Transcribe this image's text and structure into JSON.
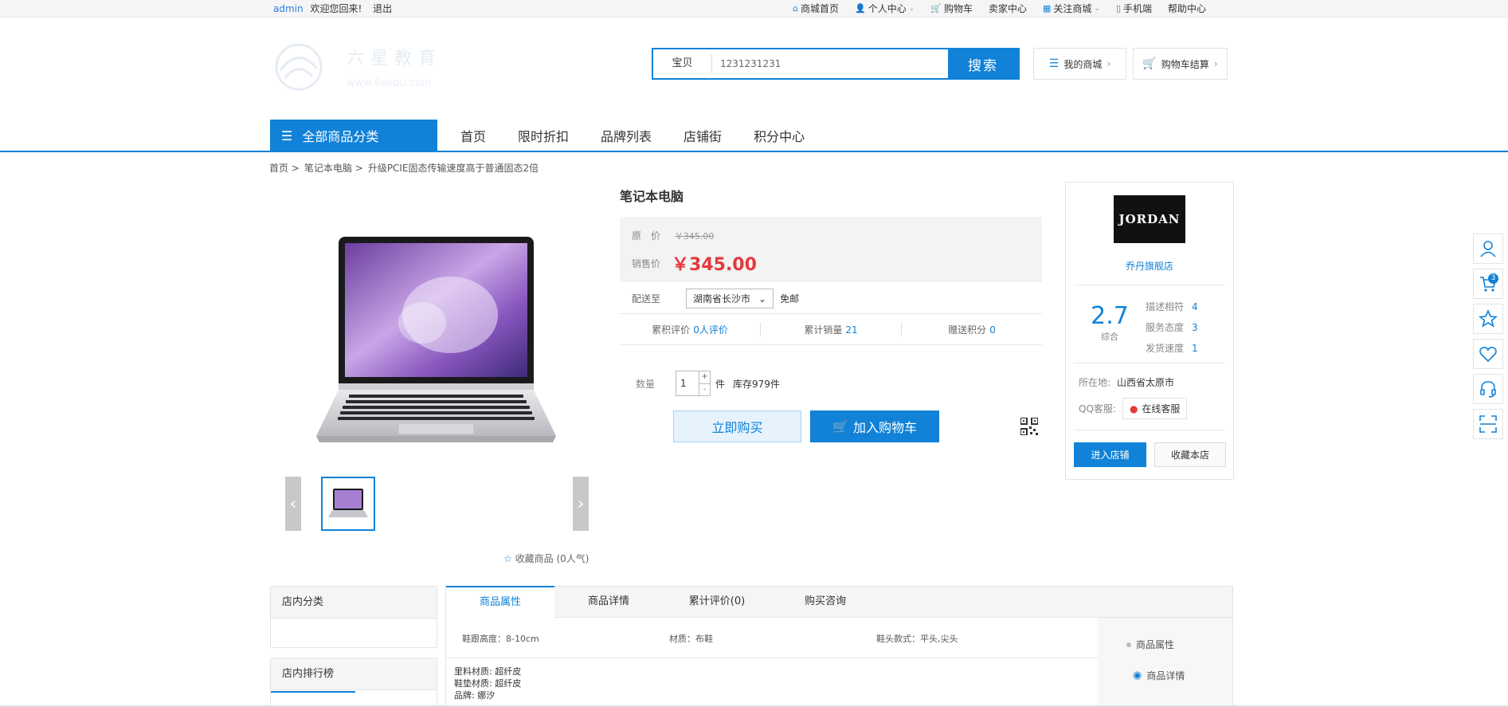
{
  "topbar": {
    "user": "admin",
    "welcome": "欢迎您回来!",
    "logout": "退出",
    "links": [
      "商城首页",
      "个人中心",
      "购物车",
      "卖家中心",
      "关注商城",
      "手机端",
      "帮助中心"
    ]
  },
  "header": {
    "search_category": "宝贝",
    "search_value": "1231231231",
    "search_button": "搜索",
    "my_mall": "我的商城",
    "cart_checkout": "购物车结算"
  },
  "nav": {
    "all_categories": "全部商品分类",
    "items": [
      "首页",
      "限时折扣",
      "品牌列表",
      "店铺街",
      "积分中心"
    ]
  },
  "breadcrumb": [
    "首页",
    ">",
    "笔记本电脑",
    ">",
    "升级PCIE固态传输速度高于普通固态2倍"
  ],
  "product": {
    "title": "笔记本电脑",
    "orig_label": "原　价",
    "orig_price": "￥345.00",
    "sale_label": "销售价",
    "sale_price": "￥345.00",
    "deliver_label": "配送至",
    "deliver_region": "湖南省长沙市",
    "shipping": "免邮",
    "reviews_label": "累积评价",
    "reviews_value": "0人评价",
    "sales_label": "累计销量",
    "sales_value": "21",
    "points_label": "赠送积分",
    "points_value": "0",
    "qty_label": "数量",
    "qty_value": "1",
    "unit": "件",
    "stock": "库存979件",
    "buy_now": "立即购买",
    "add_cart": "加入购物车",
    "favorite": "收藏商品",
    "favorite_count": "(0人气)"
  },
  "shop": {
    "logo_text": "JORDAN",
    "name": "乔丹旗舰店",
    "score": "2.7",
    "score_label": "综合",
    "desc_label": "描述相符",
    "desc_value": "4",
    "service_label": "服务态度",
    "service_value": "3",
    "ship_label": "发货速度",
    "ship_value": "1",
    "location_label": "所在地:",
    "location_value": "山西省太原市",
    "qq_label": "QQ客服:",
    "qq_button": "在线客服",
    "enter": "进入店铺",
    "collect": "收藏本店"
  },
  "floatbar": {
    "cart_count": "3"
  },
  "bottom": {
    "store_category": "店内分类",
    "store_rank": "店内排行榜",
    "tabs": [
      "商品属性",
      "商品详情",
      "累计评价(0)",
      "购买咨询"
    ],
    "attrs": [
      "鞋跟高度：8-10cm",
      "材质：布鞋",
      "鞋头款式：平头,尖头"
    ],
    "attr_lines": [
      "里料材质: 超纤皮",
      "鞋垫材质: 超纤皮",
      "品牌: 娜汐"
    ],
    "side_nav": [
      "商品属性",
      "商品详情"
    ]
  },
  "colors": {
    "accent": "#1182d8",
    "price": "#e4393c"
  }
}
